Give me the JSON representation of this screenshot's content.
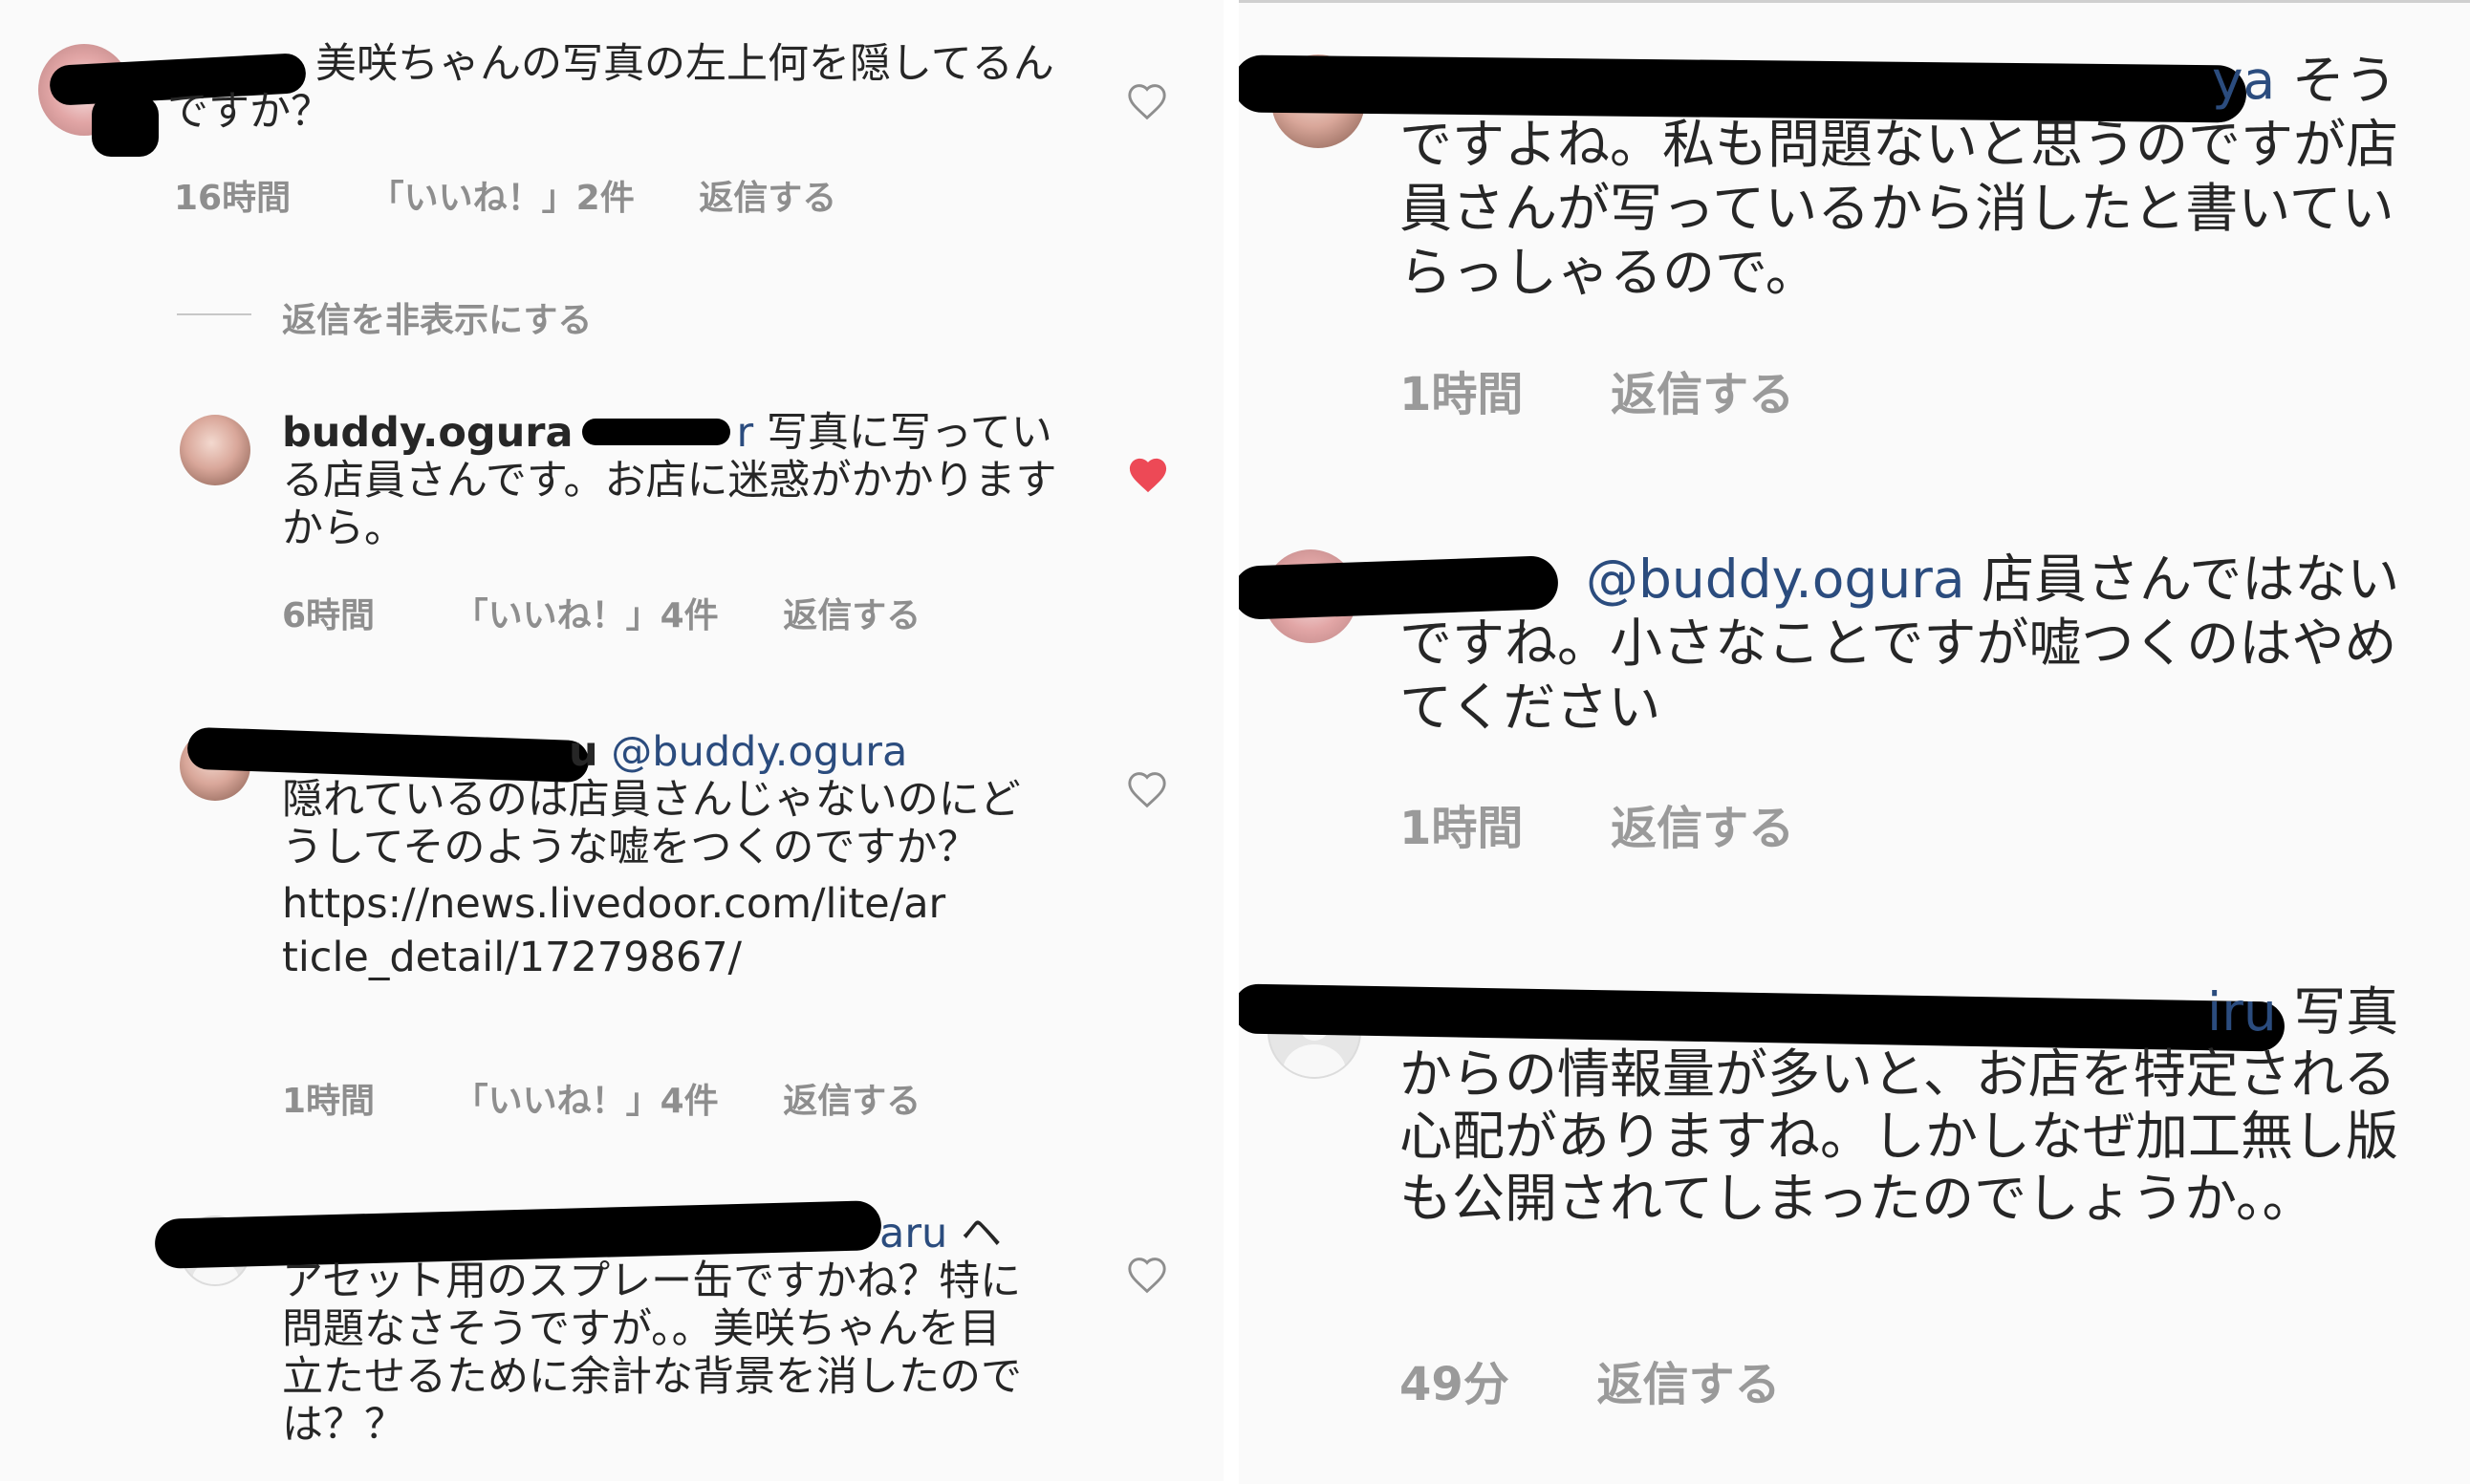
{
  "left": {
    "c1": {
      "text": "美咲ちゃんの写真の左上何を隠してるんですか？",
      "time": "16時間",
      "likes": "「いいね！」2件",
      "reply": "返信する"
    },
    "hide_replies": "返信を非表示にする",
    "c2": {
      "username": "buddy.ogura",
      "mention_tail": "r",
      "text": "写真に写っている店員さんです。お店に迷惑がかかりますから。",
      "time": "6時間",
      "likes": "「いいね！」4件",
      "reply": "返信する"
    },
    "c3": {
      "name_tail": "u",
      "mention": "@buddy.ogura",
      "text": "隠れているのは店員さんじゃないのにどうしてそのような嘘をつくのですか？",
      "link": "https://news.livedoor.com/lite/article_detail/17279867/",
      "time": "1時間",
      "likes": "「いいね！」4件",
      "reply": "返信する"
    },
    "c4": {
      "mention_tail": "aru",
      "text": "ヘアセット用のスプレー缶ですかね？特に問題なさそうですが。。美咲ちゃんを目立たせるために余計な背景を消したのでは？？"
    }
  },
  "right": {
    "r1": {
      "mention_tail": "ya",
      "text": "そうですよね。私も問題ないと思うのですが店員さんが写っているから消したと書いていらっしゃるので。",
      "time": "1時間",
      "reply": "返信する"
    },
    "r2": {
      "mention": "@buddy.ogura",
      "text": "店員さんではないですね。小さなことですが嘘つくのはやめてください",
      "time": "1時間",
      "reply": "返信する"
    },
    "r3": {
      "mention_tail": "iru",
      "text": "写真からの情報量が多いと、お店を特定される心配がありますね。しかしなぜ加工無し版も公開されてしまったのでしょうか。。",
      "time": "49分",
      "reply": "返信する"
    }
  },
  "colors": {
    "mention": "#2b4c7e",
    "liked_heart": "#ed4956",
    "meta": "#8e8e8e"
  }
}
